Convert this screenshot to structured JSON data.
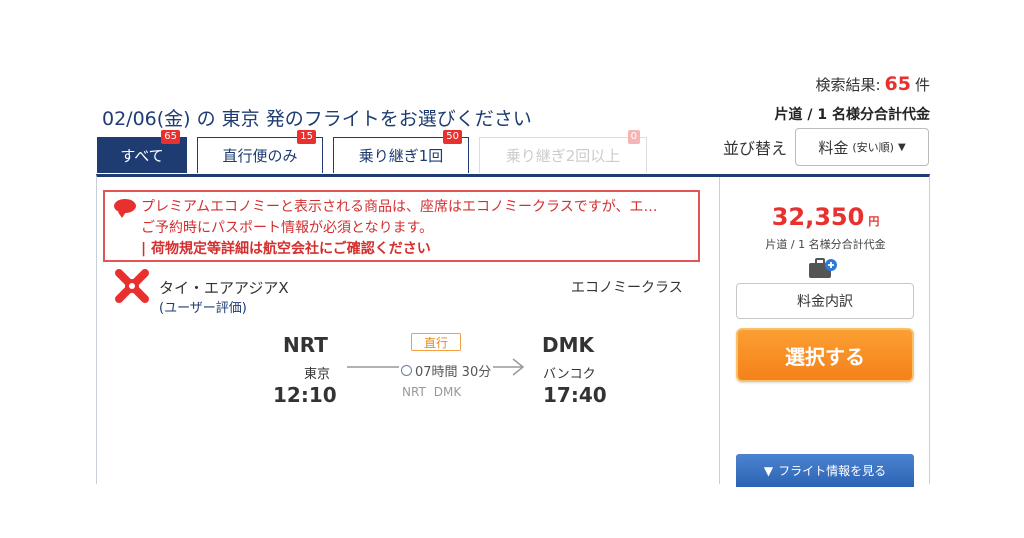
{
  "summary": {
    "results_label": "検索結果:",
    "results_count": "65",
    "results_unit": "件",
    "fare_basis": "片道 / 1 名様分合計代金",
    "heading": "02/06(金) の 東京 発のフライトをお選びください"
  },
  "tabs": [
    {
      "label": "すべて",
      "count": "65",
      "state": "active"
    },
    {
      "label": "直行便のみ",
      "count": "15",
      "state": "normal"
    },
    {
      "label": "乗り継ぎ1回",
      "count": "50",
      "state": "normal"
    },
    {
      "label": "乗り継ぎ2回以上",
      "count": "0",
      "state": "disabled"
    }
  ],
  "sort": {
    "label": "並び替え",
    "selected": "料金",
    "selected_hint": "(安い順)"
  },
  "flight": {
    "notice": {
      "line1": "プレミアムエコノミーと表示される商品は、座席はエコノミークラスですが、エ…",
      "line2": "ご予約時にパスポート情報が必須となります。",
      "line3": "| 荷物規定等詳細は航空会社にご確認ください"
    },
    "airline": "タイ・エアアジアX",
    "rating_link": "(ユーザー評価)",
    "cabin": "エコノミークラス",
    "departure": {
      "code": "NRT",
      "city": "東京",
      "time": "12:10"
    },
    "arrival": {
      "code": "DMK",
      "city": "バンコク",
      "time": "17:40"
    },
    "nonstop_badge": "直行",
    "duration": "07時間 30分",
    "route": [
      "NRT",
      "DMK"
    ]
  },
  "pricing": {
    "amount": "32,350",
    "currency": "円",
    "note": "片道 / 1 名様分合計代金",
    "breakdown_label": "料金内訳",
    "select_label": "選択する",
    "info_label": "フライト情報を見る"
  },
  "colors": {
    "navy": "#1f3c72",
    "red": "#e8312f",
    "orange": "#f5811a",
    "blue_button": "#2d63b3"
  }
}
